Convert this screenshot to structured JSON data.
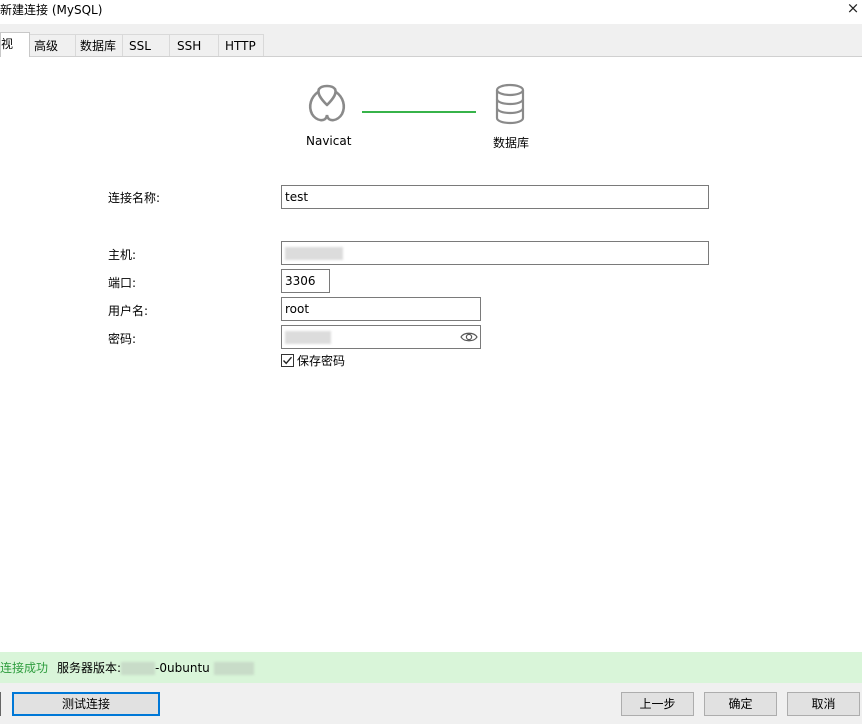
{
  "window": {
    "title": "新建连接 (MySQL)",
    "close_glyph": "×"
  },
  "tabs": [
    {
      "label": "视",
      "active": true
    },
    {
      "label": "高级"
    },
    {
      "label": "数据库"
    },
    {
      "label": "SSL"
    },
    {
      "label": "SSH"
    },
    {
      "label": "HTTP"
    }
  ],
  "diagram": {
    "left_label": "Navicat",
    "right_label": "数据库",
    "left_icon": "navicat-logo-icon",
    "right_icon": "database-icon",
    "line_color": "#37b34a"
  },
  "form": {
    "conn_name_label": "连接名称:",
    "conn_name_value": "test",
    "host_label": "主机:",
    "host_value": "",
    "port_label": "端口:",
    "port_value": "3306",
    "user_label": "用户名:",
    "user_value": "root",
    "password_label": "密码:",
    "password_value": "",
    "save_password_label": "保存密码",
    "save_password_checked": true
  },
  "status": {
    "success_text": "连接成功",
    "version_prefix": "服务器版本:",
    "version_suffix": "-0ubuntu",
    "success_color": "#2e9d3e",
    "bar_color": "#d9f5d9"
  },
  "buttons": {
    "test_connection": "测试连接",
    "back": "上一步",
    "ok": "确定",
    "cancel": "取消"
  }
}
